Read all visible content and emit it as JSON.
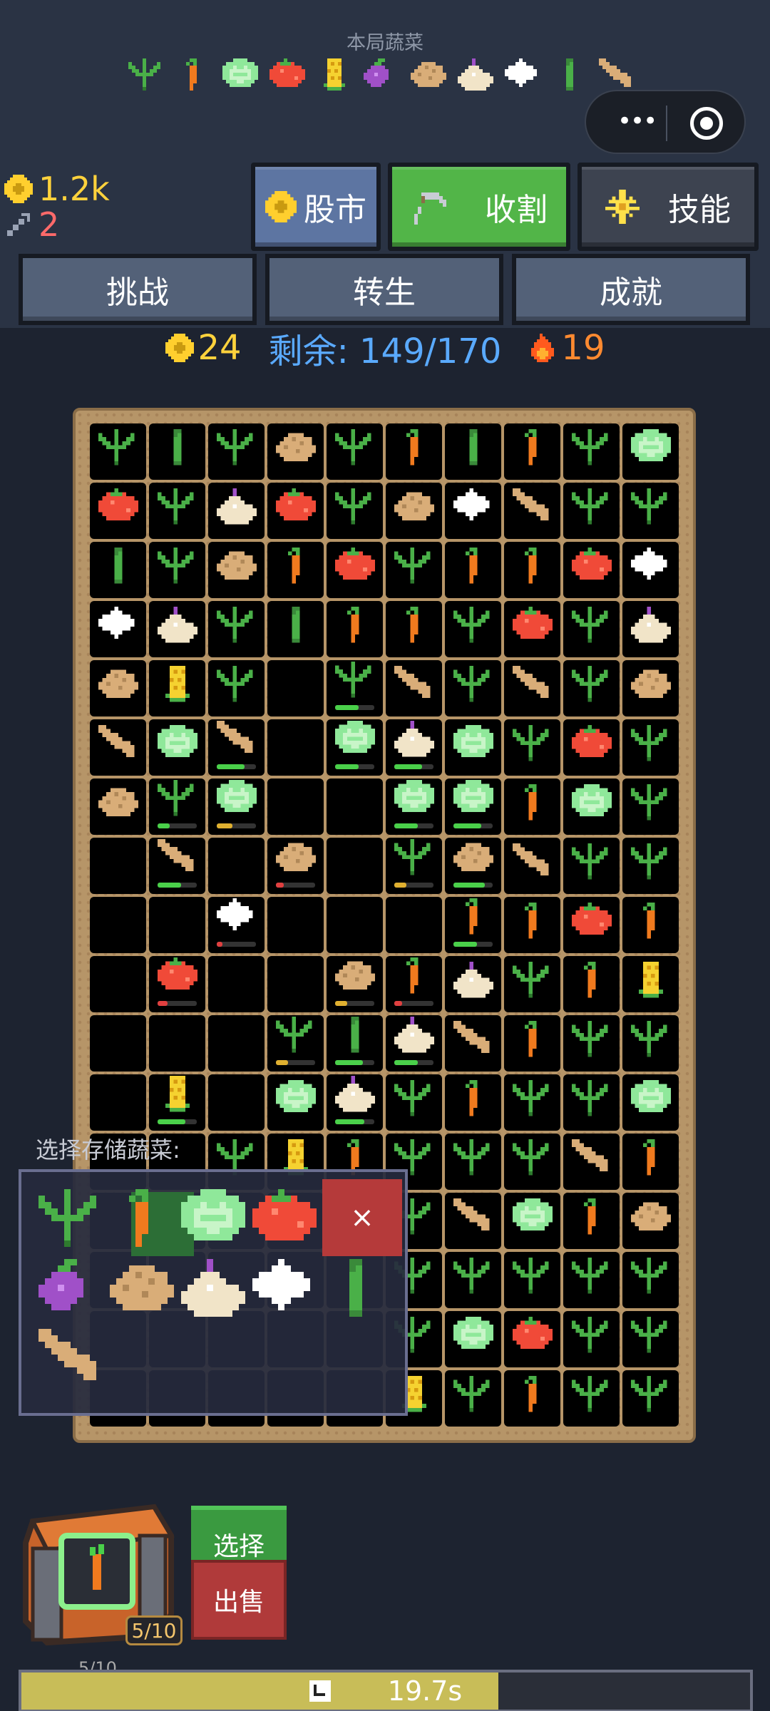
{
  "header": {
    "veg_title": "本局蔬菜",
    "veg_icons": [
      "sprout-icon",
      "carrot-icon",
      "cabbage-icon",
      "tomato-icon",
      "corn-icon",
      "eggplant-icon",
      "potato-icon",
      "onion-icon",
      "garlic-icon",
      "leek-icon",
      "ginger-icon"
    ]
  },
  "resources": {
    "gold": "1.2k",
    "pickaxe": "2"
  },
  "buttons": {
    "stock": "股市",
    "harvest": "收割",
    "skill": "技能",
    "challenge": "挑战",
    "rebirth": "转生",
    "achievement": "成就"
  },
  "stats": {
    "coins": "24",
    "remaining": "剩余: 149/170",
    "fire": "19"
  },
  "board": {
    "grid": [
      [
        "sprout",
        "leek",
        "sprout",
        "potato",
        "sprout",
        "carrot",
        "leek",
        "carrot",
        "sprout",
        "cabbage"
      ],
      [
        "tomato",
        "sprout",
        "onion",
        "tomato",
        "sprout",
        "potato",
        "garlic",
        "ginger",
        "sprout",
        "sprout"
      ],
      [
        "leek",
        "sprout",
        "potato",
        "carrot",
        "tomato",
        "sprout",
        "carrot",
        "carrot",
        "tomato",
        "garlic"
      ],
      [
        "garlic",
        "onion",
        "sprout",
        "leek",
        "carrot",
        "carrot",
        "sprout",
        "tomato",
        "sprout",
        "onion"
      ],
      [
        "potato",
        "corn",
        "sprout",
        "",
        "sprout",
        "ginger",
        "sprout",
        "ginger",
        "sprout",
        "potato"
      ],
      [
        "ginger",
        "cabbage",
        "ginger",
        "",
        "cabbage",
        "onion",
        "cabbage",
        "sprout",
        "tomato",
        "sprout"
      ],
      [
        "potato",
        "sprout",
        "cabbage",
        "",
        "",
        "cabbage",
        "cabbage",
        "carrot",
        "cabbage",
        "sprout"
      ],
      [
        "",
        "ginger",
        "",
        "potato",
        "",
        "sprout",
        "potato",
        "ginger",
        "sprout",
        "sprout"
      ],
      [
        "",
        "",
        "garlic",
        "",
        "",
        "",
        "carrot",
        "carrot",
        "tomato",
        "carrot"
      ],
      [
        "",
        "tomato",
        "",
        "",
        "potato",
        "carrot",
        "onion",
        "sprout",
        "carrot",
        "corn"
      ],
      [
        "",
        "",
        "",
        "sprout",
        "leek",
        "onion",
        "ginger",
        "carrot",
        "sprout",
        "sprout"
      ],
      [
        "",
        "corn",
        "",
        "cabbage",
        "onion",
        "sprout",
        "carrot",
        "sprout",
        "sprout",
        "cabbage"
      ],
      [
        "",
        "",
        "sprout",
        "corn",
        "carrot",
        "sprout",
        "sprout",
        "sprout",
        "ginger",
        "carrot"
      ],
      [
        "",
        "",
        "",
        "",
        "",
        "sprout",
        "ginger",
        "cabbage",
        "carrot",
        "potato"
      ],
      [
        "",
        "",
        "",
        "",
        "",
        "sprout",
        "sprout",
        "sprout",
        "sprout",
        "sprout"
      ],
      [
        "",
        "",
        "",
        "",
        "",
        "sprout",
        "cabbage",
        "tomato",
        "sprout",
        "sprout"
      ],
      [
        "",
        "",
        "",
        "",
        "",
        "corn",
        "sprout",
        "carrot",
        "sprout",
        "sprout"
      ]
    ],
    "growing": [
      [
        4,
        4,
        0.6,
        "#4ad04a"
      ],
      [
        5,
        2,
        0.7,
        "#4ad04a"
      ],
      [
        5,
        4,
        0.6,
        "#4ad04a"
      ],
      [
        5,
        5,
        0.7,
        "#4ad04a"
      ],
      [
        6,
        1,
        0.3,
        "#4ad04a"
      ],
      [
        6,
        2,
        0.4,
        "#e0b030"
      ],
      [
        6,
        5,
        0.6,
        "#4ad04a"
      ],
      [
        6,
        6,
        0.7,
        "#4ad04a"
      ],
      [
        7,
        1,
        0.6,
        "#4ad04a"
      ],
      [
        7,
        3,
        0.2,
        "#e04040"
      ],
      [
        7,
        5,
        0.3,
        "#e0b030"
      ],
      [
        7,
        6,
        0.8,
        "#4ad04a"
      ],
      [
        8,
        2,
        0.15,
        "#e04040"
      ],
      [
        8,
        6,
        0.6,
        "#4ad04a"
      ],
      [
        9,
        1,
        0.25,
        "#e04040"
      ],
      [
        9,
        4,
        0.3,
        "#e0b030"
      ],
      [
        9,
        5,
        0.2,
        "#e04040"
      ],
      [
        10,
        3,
        0.3,
        "#e0b030"
      ],
      [
        10,
        4,
        0.7,
        "#4ad04a"
      ],
      [
        10,
        5,
        0.6,
        "#4ad04a"
      ],
      [
        11,
        1,
        0.7,
        "#4ad04a"
      ],
      [
        11,
        4,
        0.75,
        "#4ad04a"
      ]
    ]
  },
  "storage": {
    "label": "选择存储蔬菜:",
    "close": "×",
    "items": [
      "sprout",
      "carrot",
      "cabbage",
      "tomato",
      "eggplant",
      "potato",
      "onion",
      "garlic",
      "leek",
      "ginger"
    ],
    "selected": "carrot"
  },
  "chest": {
    "count": "5/10",
    "under_label": "5/10"
  },
  "actions": {
    "select": "选择",
    "sell": "出售"
  },
  "progress": {
    "text": "19.7s",
    "fill": 0.655
  }
}
